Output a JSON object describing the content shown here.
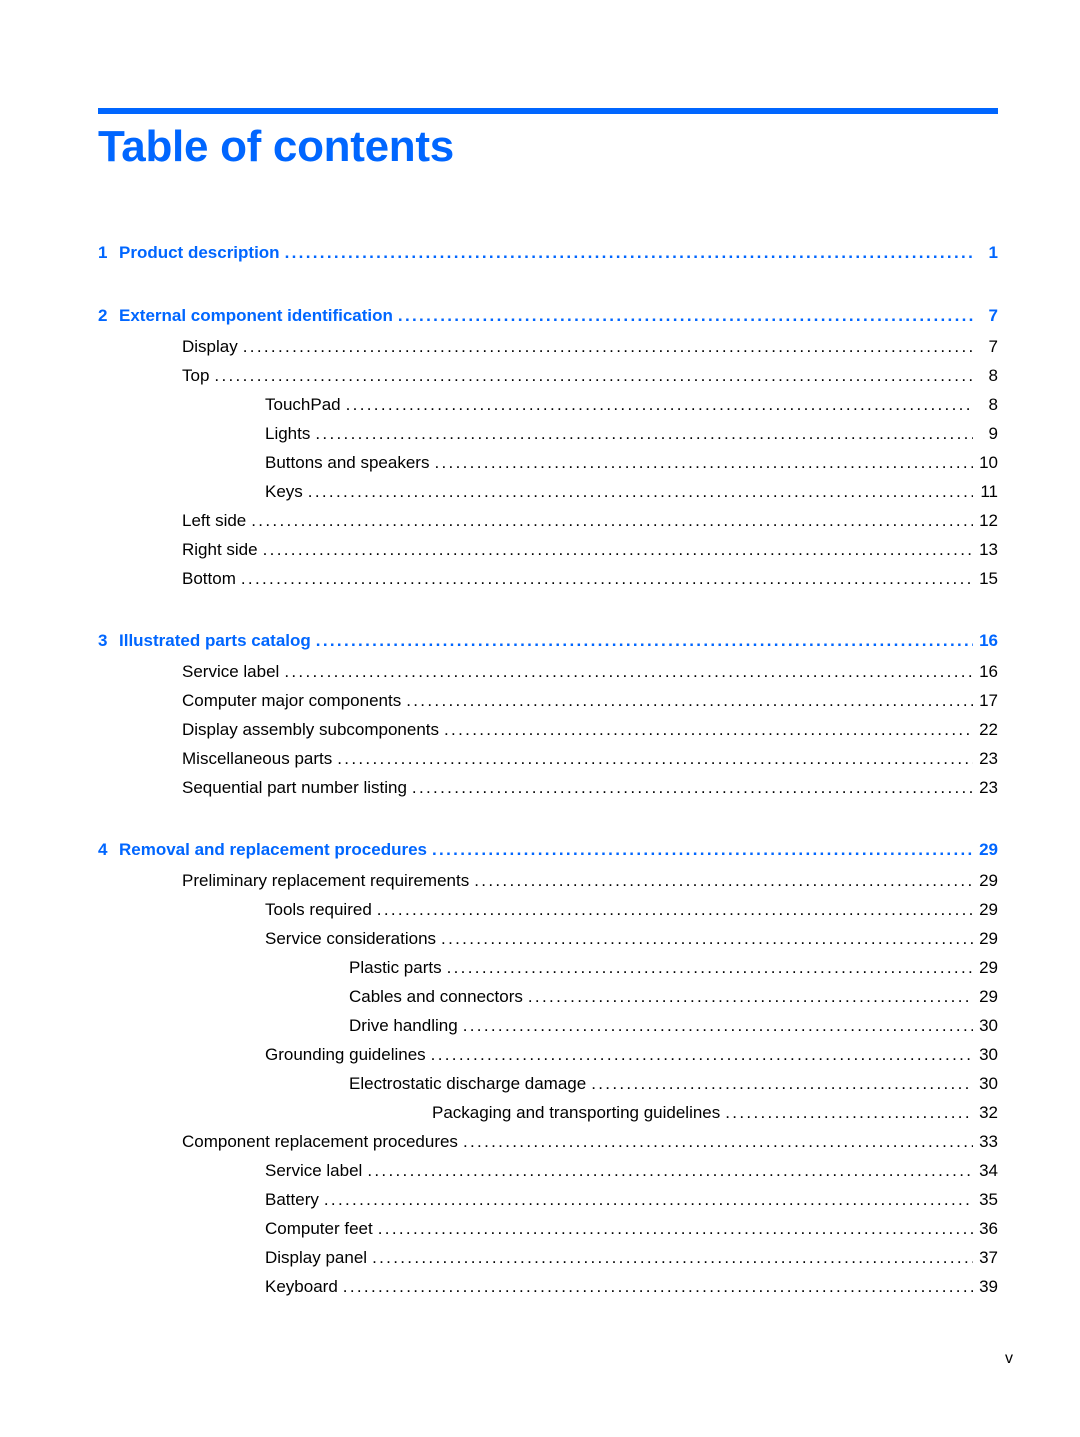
{
  "page": {
    "title": "Table of contents",
    "folio": "v",
    "accent_color": "#0066ff"
  },
  "toc": {
    "chapters": [
      {
        "number": "1",
        "label": "Product description",
        "page": "1",
        "entries": []
      },
      {
        "number": "2",
        "label": "External component identification",
        "page": "7",
        "entries": [
          {
            "level": 1,
            "label": "Display",
            "page": "7"
          },
          {
            "level": 1,
            "label": "Top",
            "page": "8"
          },
          {
            "level": 2,
            "label": "TouchPad",
            "page": "8"
          },
          {
            "level": 2,
            "label": "Lights",
            "page": "9"
          },
          {
            "level": 2,
            "label": "Buttons and speakers",
            "page": "10"
          },
          {
            "level": 2,
            "label": "Keys",
            "page": "11"
          },
          {
            "level": 1,
            "label": "Left side",
            "page": "12"
          },
          {
            "level": 1,
            "label": "Right side",
            "page": "13"
          },
          {
            "level": 1,
            "label": "Bottom",
            "page": "15"
          }
        ]
      },
      {
        "number": "3",
        "label": "Illustrated parts catalog",
        "page": "16",
        "entries": [
          {
            "level": 1,
            "label": "Service label",
            "page": "16"
          },
          {
            "level": 1,
            "label": "Computer major components",
            "page": "17"
          },
          {
            "level": 1,
            "label": "Display assembly subcomponents",
            "page": "22"
          },
          {
            "level": 1,
            "label": "Miscellaneous parts",
            "page": "23"
          },
          {
            "level": 1,
            "label": "Sequential part number listing",
            "page": "23"
          }
        ]
      },
      {
        "number": "4",
        "label": "Removal and replacement procedures",
        "page": "29",
        "entries": [
          {
            "level": 1,
            "label": "Preliminary replacement requirements",
            "page": "29"
          },
          {
            "level": 2,
            "label": "Tools required",
            "page": "29"
          },
          {
            "level": 2,
            "label": "Service considerations",
            "page": "29"
          },
          {
            "level": 3,
            "label": "Plastic parts",
            "page": "29"
          },
          {
            "level": 3,
            "label": "Cables and connectors",
            "page": "29"
          },
          {
            "level": 3,
            "label": "Drive handling",
            "page": "30"
          },
          {
            "level": 2,
            "label": "Grounding guidelines",
            "page": "30"
          },
          {
            "level": 3,
            "label": "Electrostatic discharge damage",
            "page": "30"
          },
          {
            "level": 4,
            "label": "Packaging and transporting guidelines",
            "page": "32"
          },
          {
            "level": 1,
            "label": "Component replacement procedures",
            "page": "33"
          },
          {
            "level": 2,
            "label": "Service label",
            "page": "34"
          },
          {
            "level": 2,
            "label": "Battery",
            "page": "35"
          },
          {
            "level": 2,
            "label": "Computer feet",
            "page": "36"
          },
          {
            "level": 2,
            "label": "Display panel",
            "page": "37"
          },
          {
            "level": 2,
            "label": "Keyboard",
            "page": "39"
          }
        ]
      }
    ]
  }
}
